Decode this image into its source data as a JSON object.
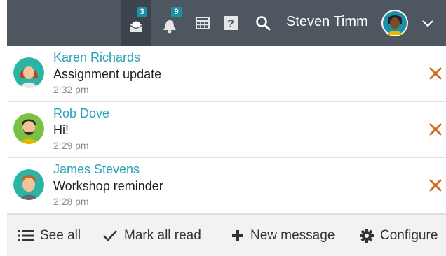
{
  "header": {
    "messages_badge": "3",
    "notifications_badge": "9",
    "user_name": "Steven Timm",
    "icons": [
      "messages-icon",
      "notifications-icon",
      "calendar-icon",
      "help-icon",
      "search-icon",
      "chevron-down-icon"
    ]
  },
  "messages": [
    {
      "sender": "Karen Richards",
      "subject": "Assignment update",
      "time": "2:32 pm"
    },
    {
      "sender": "Rob Dove",
      "subject": "Hi!",
      "time": "2:29 pm"
    },
    {
      "sender": "James Stevens",
      "subject": "Workshop reminder",
      "time": "2:28 pm"
    }
  ],
  "footer": {
    "see_all": "See all",
    "mark_all_read": "Mark all read",
    "new_message": "New message",
    "configure": "Configure"
  },
  "colors": {
    "header_bg": "#4e5660",
    "accent": "#27a3b8",
    "badge": "#1a8fa6",
    "dismiss": "#d2691e"
  }
}
